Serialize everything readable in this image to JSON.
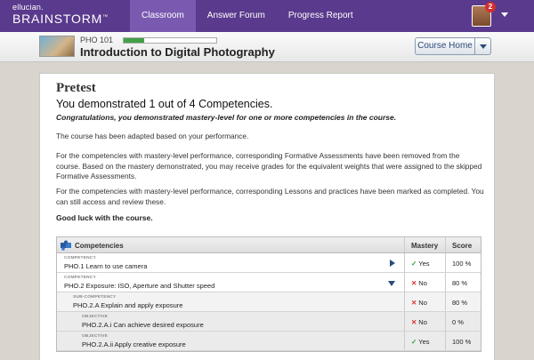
{
  "brand": {
    "top": "ellucian.",
    "main": "BRAINSTORM",
    "tm": "™"
  },
  "nav": {
    "tabs": [
      {
        "label": "Classroom"
      },
      {
        "label": "Answer Forum"
      },
      {
        "label": "Progress Report"
      }
    ]
  },
  "user": {
    "notification_count": "2"
  },
  "course": {
    "code": "PHO 101",
    "title": "Introduction to Digital Photography",
    "progress": 0.22,
    "home_button": "Course Home"
  },
  "pretest": {
    "title": "Pretest",
    "summary": "You demonstrated 1 out of 4 Competencies.",
    "congrats": "Congratulations, you demonstrated mastery-level for one or more competencies in the course.",
    "p1": "The course has been adapted based on your performance.",
    "p2": "For the competencies with mastery-level performance, corresponding Formative Assessments have been removed from the course. Based on the mastery demonstrated, you may receive grades for the equivalent weights that were assigned to the skipped Formative Assessments.",
    "p3": "For the competencies with mastery-level performance, corresponding Lessons and practices have been marked as completed. You can still access and review these.",
    "good_luck": "Good luck with the course."
  },
  "table": {
    "headers": {
      "competencies": "Competencies",
      "mastery": "Mastery",
      "score": "Score"
    },
    "rows": [
      {
        "type": "COMPETENCY",
        "label": "PHO.1 Learn to use camera",
        "mastery": "Yes",
        "score": "100 %"
      },
      {
        "type": "COMPETENCY",
        "label": "PHO.2 Exposure: ISO, Aperture and Shutter speed",
        "mastery": "No",
        "score": "80 %"
      },
      {
        "type": "SUB-COMPETENCY",
        "label": "PHO.2.A Explain and apply exposure",
        "mastery": "No",
        "score": "80 %"
      },
      {
        "type": "OBJECTIVE",
        "label": "PHO.2.A.i Can achieve desired exposure",
        "mastery": "No",
        "score": "0 %"
      },
      {
        "type": "OBJECTIVE",
        "label": "PHO.2.A.ii Apply creative exposure",
        "mastery": "Yes",
        "score": "100 %"
      }
    ]
  },
  "marks": {
    "yes": "✓",
    "no": "✕"
  },
  "colors": {
    "nav": "#5a3a8c",
    "nav_active": "#7a5ab0",
    "progress": "#43a047",
    "yes": "#2e9b3a",
    "no": "#d32f2f"
  }
}
